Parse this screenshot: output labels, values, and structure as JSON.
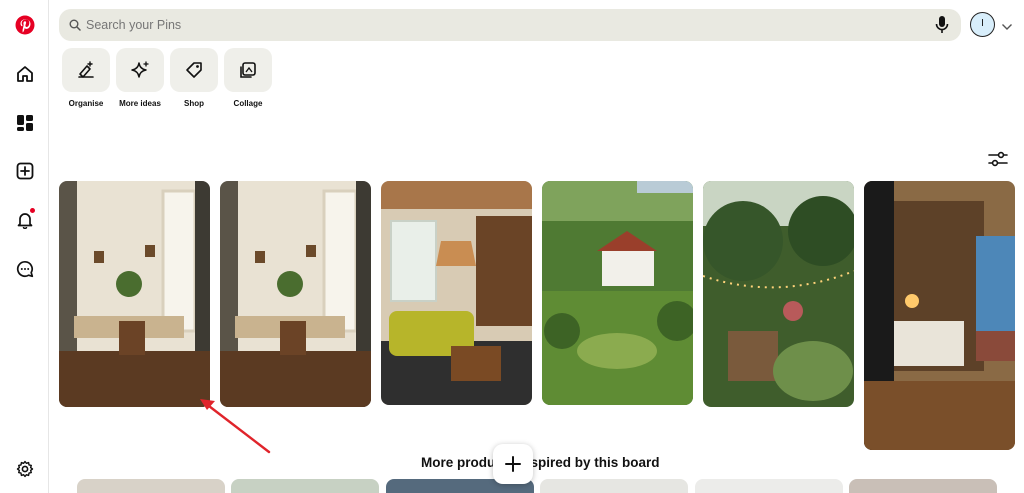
{
  "search": {
    "placeholder": "Search your Pins"
  },
  "avatar": {
    "initial": "I"
  },
  "tools": [
    {
      "label": "Organise",
      "icon": "organise-icon"
    },
    {
      "label": "More ideas",
      "icon": "sparkle-icon"
    },
    {
      "label": "Shop",
      "icon": "tag-icon"
    },
    {
      "label": "Collage",
      "icon": "collage-icon"
    }
  ],
  "sidebar": {
    "items": [
      {
        "name": "pinterest-logo-icon"
      },
      {
        "name": "home-icon"
      },
      {
        "name": "boards-icon"
      },
      {
        "name": "create-icon"
      },
      {
        "name": "notifications-icon"
      },
      {
        "name": "messages-icon"
      },
      {
        "name": "settings-icon"
      }
    ]
  },
  "pins": [
    {
      "name": "cozy-nook-window-pin"
    },
    {
      "name": "cozy-nook-window-pin-copy"
    },
    {
      "name": "yellow-sofa-living-room-pin"
    },
    {
      "name": "cottage-garden-pin"
    },
    {
      "name": "string-lights-garden-pin"
    },
    {
      "name": "bedroom-bookshelf-pin"
    }
  ],
  "section": {
    "heading": "More products inspired by this board"
  },
  "colors": {
    "brand": "#e60023",
    "annotation_arrow": "#e0242b",
    "search_bg": "#e9e9e1"
  }
}
